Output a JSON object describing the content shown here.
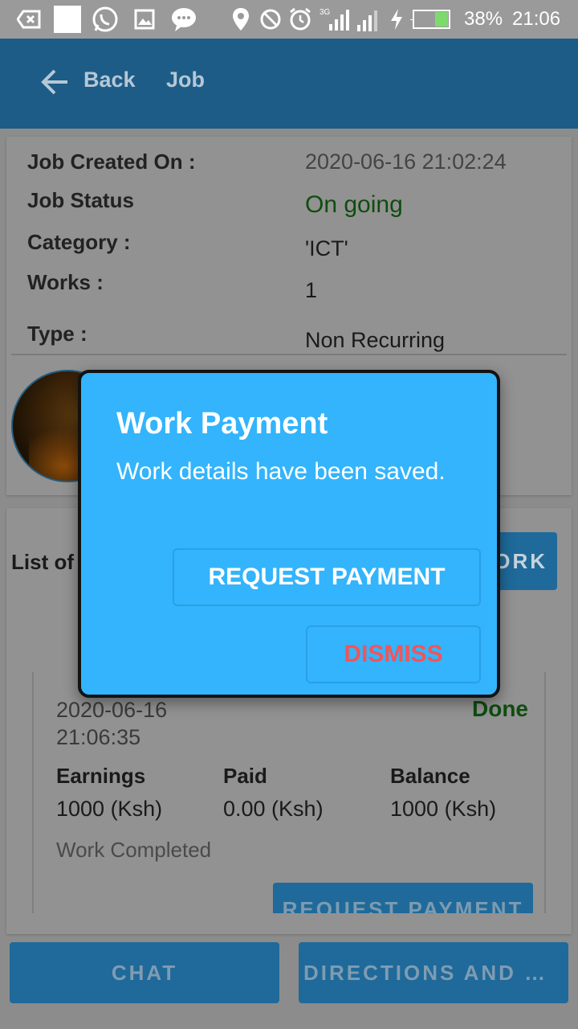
{
  "status_bar": {
    "battery_percent": "38%",
    "time": "21:06",
    "network_type": "3G",
    "icons": [
      "exit-icon",
      "blank-square-icon",
      "whatsapp-icon",
      "image-icon",
      "chat-bubble-icon",
      "location-pin-icon",
      "do-not-disturb-icon",
      "alarm-icon",
      "signal-3g-icon",
      "signal-icon",
      "charging-icon",
      "battery-icon"
    ]
  },
  "app_bar": {
    "back_label": "Back",
    "title": "Job",
    "background": "#1d5c86"
  },
  "job_details": {
    "rows": [
      {
        "label": "Job Created On :",
        "value": "2020-06-16 21:02:24"
      },
      {
        "label": "Job Status",
        "value": "On going"
      },
      {
        "label": "Category :",
        "value": "'ICT'"
      },
      {
        "label": "Works :",
        "value": "1"
      },
      {
        "label": "Type :",
        "value": "Non Recurring"
      }
    ]
  },
  "works": {
    "list_title": "List of",
    "add_button_label": "ORK",
    "items": [
      {
        "date": "2020-06-16 21:06:35",
        "status": "Done",
        "earnings_label": "Earnings",
        "earnings_value": "1000  (Ksh)",
        "paid_label": "Paid",
        "paid_value": "0.00  (Ksh)",
        "balance_label": "Balance",
        "balance_value": "1000  (Ksh)",
        "note": "Work Completed",
        "request_button_label": "REQUEST PAYMENT"
      }
    ]
  },
  "bottom_actions": {
    "chat_label": "CHAT",
    "directions_label": "DIRECTIONS AND M…"
  },
  "dialog": {
    "title": "Work Payment",
    "message": "Work details have been saved.",
    "request_payment_label": "REQUEST PAYMENT",
    "dismiss_label": "DISMISS",
    "background": "#33b4fc",
    "dismiss_color": "#f0555a"
  }
}
